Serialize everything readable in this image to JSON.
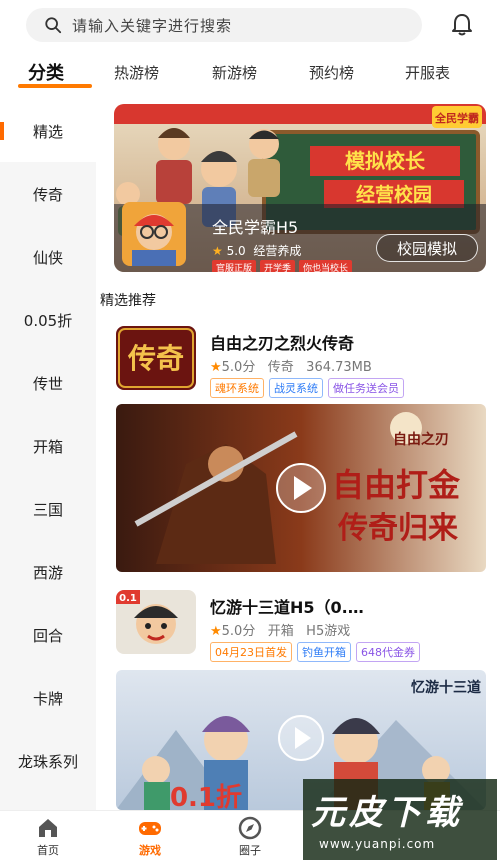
{
  "search": {
    "placeholder": "请输入关键字进行搜索"
  },
  "top_tabs": [
    {
      "label": "分类",
      "active": true
    },
    {
      "label": "热游榜"
    },
    {
      "label": "新游榜"
    },
    {
      "label": "预约榜"
    },
    {
      "label": "开服表"
    }
  ],
  "sidebar": {
    "items": [
      {
        "label": "精选",
        "active": true
      },
      {
        "label": "传奇"
      },
      {
        "label": "仙侠"
      },
      {
        "label": "0.05折"
      },
      {
        "label": "传世"
      },
      {
        "label": "开箱"
      },
      {
        "label": "三国"
      },
      {
        "label": "西游"
      },
      {
        "label": "回合"
      },
      {
        "label": "卡牌"
      },
      {
        "label": "龙珠系列"
      }
    ]
  },
  "banner": {
    "title": "全民学霸H5",
    "rating": "5.0",
    "category": "经营养成",
    "button": "校园模拟",
    "art_headline_1": "模拟校长",
    "art_headline_2": "经营校园",
    "art_logo": "全民学霸",
    "tags": [
      "官服正版",
      "开学季",
      "你也当校长"
    ]
  },
  "section": {
    "title": "精选推荐"
  },
  "games": [
    {
      "name": "自由之刃之烈火传奇",
      "rating": "5.0分",
      "category": "传奇",
      "size": "364.73MB",
      "icon_text": "传奇",
      "tags": [
        {
          "label": "魂环系统",
          "color": "orange"
        },
        {
          "label": "战灵系统",
          "color": "blue"
        },
        {
          "label": "做任务送会员",
          "color": "purple"
        }
      ],
      "promo_logo": "自由之刃",
      "promo_line_1": "自由打金",
      "promo_line_2": "传奇归来"
    },
    {
      "name": "忆游十三道H5（0.…",
      "rating": "5.0分",
      "category": "开箱",
      "size": "H5游戏",
      "icon_badge": "0.1",
      "tags": [
        {
          "label": "04月23日首发",
          "color": "orange"
        },
        {
          "label": "钓鱼开箱",
          "color": "blue"
        },
        {
          "label": "648代金券",
          "color": "purple"
        }
      ],
      "promo_logo": "忆游十三道",
      "promo_line_1": "0.1折"
    }
  ],
  "bottom_nav": [
    {
      "label": "首页",
      "icon": "home-icon"
    },
    {
      "label": "游戏",
      "icon": "gamepad-icon",
      "active": true
    },
    {
      "label": "圈子",
      "icon": "compass-icon"
    }
  ],
  "watermark": {
    "logo": "元皮下载",
    "url": "www.yuanpi.com"
  },
  "colors": {
    "accent": "#ff6a00",
    "sidebar_bg": "#f6f6f6"
  }
}
